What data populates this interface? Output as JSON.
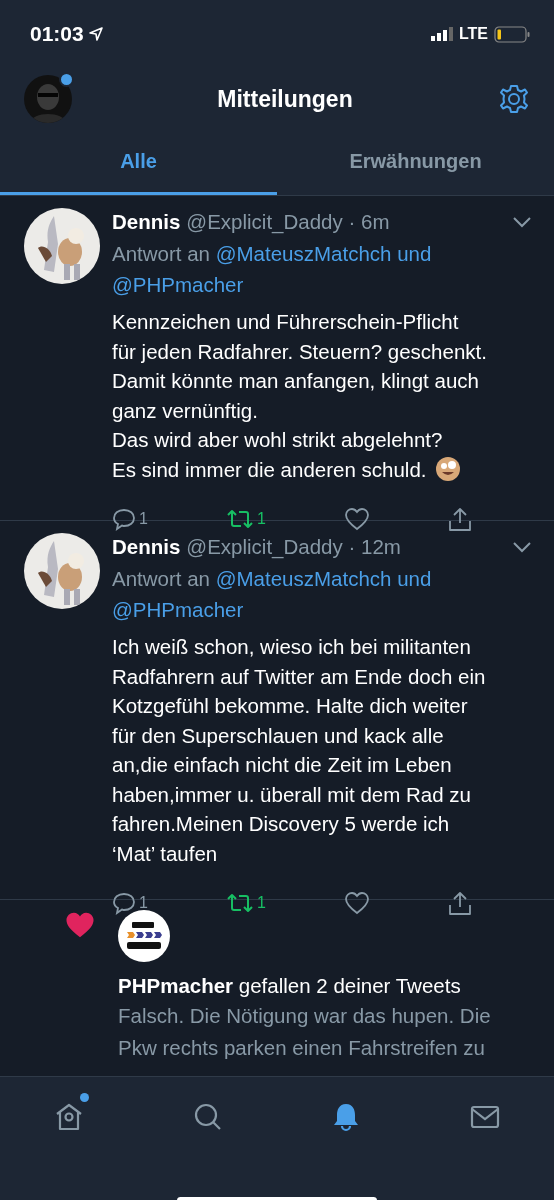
{
  "status_bar": {
    "time": "01:03",
    "network": "LTE"
  },
  "header": {
    "title": "Mitteilungen",
    "avatar_dot": true
  },
  "tabs": [
    {
      "label": "Alle",
      "selected": true
    },
    {
      "label": "Erwähnungen",
      "selected": false
    }
  ],
  "tweets": [
    {
      "name": "Dennis",
      "meta": "@Explicit_Daddy · 6m",
      "reply_prefix": "Antwort an",
      "reply_to": [
        "@MateuszMatchch und",
        "@PHPmacher"
      ],
      "lines": [
        "Kennzeichen und Führerschein-Pflicht",
        "für jeden Radfahrer. Steuern? geschenkt.",
        "Damit könnte man anfangen, klingt auch",
        "ganz vernünftig.",
        "Das wird aber wohl strikt abgelehnt?",
        "Es sind immer die anderen schuld."
      ],
      "trailing_emoji": true,
      "replies": "1",
      "retweets": "1",
      "retweeted": true,
      "liked": false
    },
    {
      "name": "Dennis",
      "meta": "@Explicit_Daddy · 12m",
      "reply_prefix": "Antwort an",
      "reply_to": [
        "@MateuszMatchch und",
        "@PHPmacher"
      ],
      "lines": [
        "Ich weiß schon, wieso ich bei militanten",
        "Radfahrern auf Twitter am Ende doch ein",
        "Kotzgefühl bekomme. Halte dich weiter",
        "für den Superschlauen und kack alle",
        "an,die einfach nicht die Zeit im Leben",
        "haben,immer u. überall mit dem Rad zu",
        "fahren.Meinen Discovery 5 werde ich",
        "‘Mat’ taufen"
      ],
      "trailing_emoji": false,
      "replies": "1",
      "retweets": "1",
      "retweeted": true,
      "liked": false
    }
  ],
  "notification": {
    "kind": "like",
    "name": "PHPmacher",
    "text": " gefallen 2 deiner Tweets",
    "preview": [
      "Falsch. Die Nötigung war das hupen. Die",
      "Pkw rechts parken einen Fahrstreifen zu"
    ]
  },
  "nav": [
    {
      "kind": "home",
      "selected": false,
      "dot": true
    },
    {
      "kind": "search",
      "selected": false,
      "dot": false
    },
    {
      "kind": "notifications",
      "selected": true,
      "dot": false
    },
    {
      "kind": "messages",
      "selected": false,
      "dot": false
    }
  ]
}
